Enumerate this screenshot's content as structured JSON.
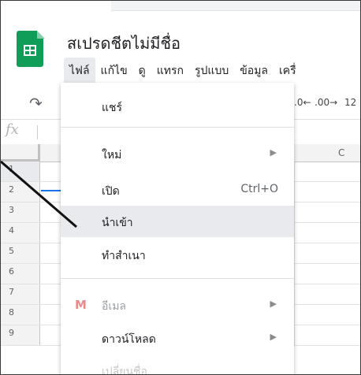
{
  "header": {
    "doc_title": "สเปรดชีตไม่มีชื่อ",
    "menus": [
      "ไฟล์",
      "แก้ไข",
      "ดู",
      "แทรก",
      "รูปแบบ",
      "ข้อมูล",
      "เครื่"
    ]
  },
  "toolbar": {
    "undo_icon": "undo-icon",
    "decimal_decrease": ".0←",
    "decimal_increase": ".00→",
    "format_number": "12"
  },
  "formula_bar": {
    "fx": "fx"
  },
  "grid": {
    "column_c": "C",
    "row_numbers": [
      "1",
      "2",
      "3",
      "4",
      "5",
      "6",
      "7",
      "8",
      "9"
    ]
  },
  "file_menu": {
    "items": [
      {
        "label": "แชร์"
      },
      {
        "label": "ใหม่",
        "submenu": true
      },
      {
        "label": "เปิด",
        "shortcut": "Ctrl+O"
      },
      {
        "label": "นำเข้า",
        "highlighted": true
      },
      {
        "label": "ทำสำเนา"
      },
      {
        "label": "อีเมล",
        "submenu": true,
        "disabled": true,
        "icon": "gmail-icon"
      },
      {
        "label": "ดาวน์โหลด",
        "submenu": true
      }
    ],
    "cut_off_item": "เปลี่ยนชื่อ"
  },
  "colors": {
    "sheets_green": "#0f9d58",
    "selection_blue": "#1a73e8",
    "hover_gray": "#e8eaed"
  }
}
